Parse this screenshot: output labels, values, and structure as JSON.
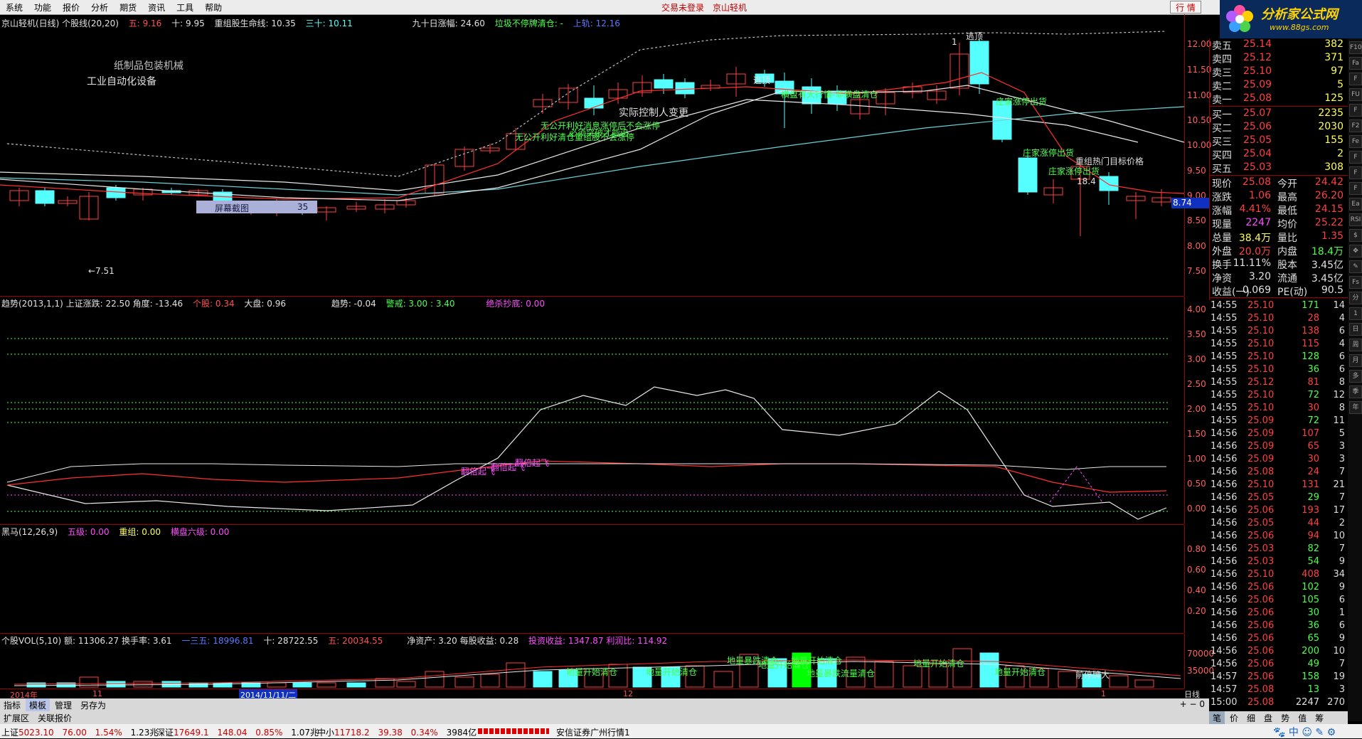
{
  "menu": {
    "items": [
      "系统",
      "功能",
      "报价",
      "分析",
      "期货",
      "资讯",
      "工具",
      "帮助"
    ],
    "center": [
      "交易未登录",
      "京山轻机"
    ],
    "quote_button": "行 情"
  },
  "logo": {
    "title": "分析家公式网",
    "url_text": "www.88gs.com"
  },
  "main_panel": {
    "header": [
      {
        "text": "京山轻机(日线) 个股线(20,20)",
        "cls": "w"
      },
      {
        "text": "五: 9.16",
        "cls": "r"
      },
      {
        "text": "十: 9.95",
        "cls": "w"
      },
      {
        "text": "重组股生命线: 10.35",
        "cls": "w"
      },
      {
        "text": "三十: 10.11",
        "cls": "c"
      },
      {
        "text": "九十日涨幅: 24.60",
        "cls": "w"
      },
      {
        "text": "垃圾不停牌清仓: -",
        "cls": "g"
      },
      {
        "text": "上轨: 12.16",
        "cls": "b"
      }
    ],
    "sector_labels": [
      "纸制品包装机械",
      "工业自动化设备"
    ],
    "y_labels": [
      "12.00",
      "11.50",
      "11.00",
      "10.50",
      "10.00",
      "9.50",
      "9.00",
      "8.50",
      "8.00",
      "7.50"
    ],
    "current_price_label": "8.74",
    "screenshot_box": {
      "label": "屏幕截图",
      "value": "35"
    },
    "low_marker": "←7.51",
    "annotations": [
      {
        "text": "逃顶",
        "cls": "w"
      },
      {
        "text": "逃顶",
        "cls": "w"
      },
      {
        "text": "实际控制人变更",
        "cls": "w"
      },
      {
        "text": "无公开利好消息涨停后不会涨停",
        "cls": "g"
      },
      {
        "text": "必须突破才能追",
        "cls": "g"
      },
      {
        "text": "无公开利好清仓重组股不会涨停",
        "cls": "g"
      },
      {
        "text": "横盘有大行情-非横盘清仓",
        "cls": "g"
      },
      {
        "text": "庄家涨停出货",
        "cls": "g"
      },
      {
        "text": "庄家涨停出货",
        "cls": "g"
      },
      {
        "text": "重组热门目标价格",
        "cls": "w"
      },
      {
        "text": "庄家涨停出货",
        "cls": "g"
      },
      {
        "text": "18.4",
        "cls": "w"
      },
      {
        "text": "1",
        "cls": "w"
      }
    ]
  },
  "trend_panel": {
    "header": [
      {
        "text": "趋势(2013,1,1) 上证涨跌: 22.50 角度: -13.46",
        "cls": "w"
      },
      {
        "text": "个股: 0.34",
        "cls": "r"
      },
      {
        "text": "大盘: 0.96",
        "cls": "w"
      },
      {
        "text": "趋势: -0.04",
        "cls": "w"
      },
      {
        "text": "警戒: 3.00 : 3.40",
        "cls": "g"
      },
      {
        "text": "绝杀抄底: 0.00",
        "cls": "m"
      }
    ],
    "y_labels": [
      "4.00",
      "3.50",
      "3.00",
      "2.50",
      "2.00",
      "1.50",
      "1.00",
      "0.50",
      "0.00"
    ],
    "annotations": [
      "翻倍起飞",
      "翻倍起飞",
      "翻倍起飞"
    ]
  },
  "horse_panel": {
    "header": [
      {
        "text": "黑马(12,26,9)",
        "cls": "w"
      },
      {
        "text": "五级: 0.00",
        "cls": "m"
      },
      {
        "text": "重组: 0.00",
        "cls": "y"
      },
      {
        "text": "横盘六级: 0.00",
        "cls": "m"
      }
    ],
    "y_labels": [
      "0.80",
      "0.60",
      "0.40",
      "0.20"
    ]
  },
  "vol_panel": {
    "header": [
      {
        "text": "个股VOL(5,10) 额: 11306.27 换手率: 3.61",
        "cls": "w"
      },
      {
        "text": "一三五: 18996.81",
        "cls": "b"
      },
      {
        "text": "十: 28722.55",
        "cls": "w"
      },
      {
        "text": "五: 20034.55",
        "cls": "r"
      },
      {
        "text": "净资产: 3.20 每股收益: 0.28",
        "cls": "w"
      },
      {
        "text": "投资收益: 1347.87 利润比: 114.92",
        "cls": "m"
      }
    ],
    "y_labels": [
      "70000",
      "35000"
    ],
    "annotations": [
      "地量开始清仓",
      "地量开始清仓",
      "地量暴跌清仓",
      "地量开始清仓",
      "地量开始清仓",
      "地量暴跌流量清仓",
      "地量开始清仓",
      "地量开始清仓",
      "前停牌大"
    ]
  },
  "date_axis": {
    "labels": [
      "2014年",
      "11",
      "2014/11/11/二",
      "12",
      "1"
    ],
    "period": "日线"
  },
  "tabs": {
    "row1": [
      "指标",
      "模板",
      "管理",
      "另存为"
    ],
    "row2": [
      "扩展区",
      "关联报价"
    ]
  },
  "quote_panel": {
    "asks": [
      {
        "label": "卖五",
        "price": "25.14",
        "vol": "382"
      },
      {
        "label": "卖四",
        "price": "25.12",
        "vol": "371"
      },
      {
        "label": "卖三",
        "price": "25.10",
        "vol": "97"
      },
      {
        "label": "卖二",
        "price": "25.09",
        "vol": "5"
      },
      {
        "label": "卖一",
        "price": "25.08",
        "vol": "125"
      }
    ],
    "bids": [
      {
        "label": "买一",
        "price": "25.07",
        "vol": "2235"
      },
      {
        "label": "买二",
        "price": "25.06",
        "vol": "2030"
      },
      {
        "label": "买三",
        "price": "25.05",
        "vol": "155"
      },
      {
        "label": "买四",
        "price": "25.04",
        "vol": "2"
      },
      {
        "label": "买五",
        "price": "25.03",
        "vol": "308"
      }
    ],
    "stats": [
      {
        "l1": "现价",
        "v1": "25.08",
        "c1": "r",
        "l2": "今开",
        "v2": "24.42",
        "c2": "r"
      },
      {
        "l1": "涨跌",
        "v1": "1.06",
        "c1": "r",
        "l2": "最高",
        "v2": "26.20",
        "c2": "r"
      },
      {
        "l1": "涨幅",
        "v1": "4.41%",
        "c1": "r",
        "l2": "最低",
        "v2": "24.15",
        "c2": "r"
      },
      {
        "l1": "现量",
        "v1": "2247",
        "c1": "m",
        "l2": "均价",
        "v2": "25.22",
        "c2": "r"
      },
      {
        "l1": "总量",
        "v1": "38.4万",
        "c1": "y",
        "l2": "量比",
        "v2": "1.35",
        "c2": "r"
      },
      {
        "l1": "外盘",
        "v1": "20.0万",
        "c1": "r",
        "l2": "内盘",
        "v2": "18.4万",
        "c2": "g"
      },
      {
        "l1": "换手",
        "v1": "11.11%",
        "c1": "w",
        "l2": "股本",
        "v2": "3.45亿",
        "c2": "w"
      },
      {
        "l1": "净资",
        "v1": "3.20",
        "c1": "w",
        "l2": "流通",
        "v2": "3.45亿",
        "c2": "w"
      },
      {
        "l1": "收益(一)",
        "v1": "0.069",
        "c1": "w",
        "l2": "PE(动)",
        "v2": "90.5",
        "c2": "w"
      }
    ],
    "ticks": [
      {
        "t": "14:55",
        "p": "25.10",
        "v": "171",
        "n": "14",
        "c": "g"
      },
      {
        "t": "14:55",
        "p": "25.10",
        "v": "28",
        "n": "4",
        "c": "r"
      },
      {
        "t": "14:55",
        "p": "25.10",
        "v": "138",
        "n": "6",
        "c": "r"
      },
      {
        "t": "14:55",
        "p": "25.10",
        "v": "115",
        "n": "4",
        "c": "r"
      },
      {
        "t": "14:55",
        "p": "25.10",
        "v": "128",
        "n": "6",
        "c": "g"
      },
      {
        "t": "14:55",
        "p": "25.10",
        "v": "36",
        "n": "6",
        "c": "g"
      },
      {
        "t": "14:55",
        "p": "25.12",
        "v": "81",
        "n": "8",
        "c": "r"
      },
      {
        "t": "14:55",
        "p": "25.10",
        "v": "72",
        "n": "12",
        "c": "g"
      },
      {
        "t": "14:55",
        "p": "25.10",
        "v": "30",
        "n": "8",
        "c": "r"
      },
      {
        "t": "14:55",
        "p": "25.09",
        "v": "72",
        "n": "11",
        "c": "g"
      },
      {
        "t": "14:56",
        "p": "25.09",
        "v": "107",
        "n": "5",
        "c": "r"
      },
      {
        "t": "14:56",
        "p": "25.09",
        "v": "65",
        "n": "3",
        "c": "r"
      },
      {
        "t": "14:56",
        "p": "25.09",
        "v": "30",
        "n": "3",
        "c": "r"
      },
      {
        "t": "14:56",
        "p": "25.08",
        "v": "24",
        "n": "7",
        "c": "r"
      },
      {
        "t": "14:56",
        "p": "25.10",
        "v": "131",
        "n": "21",
        "c": "r"
      },
      {
        "t": "14:56",
        "p": "25.05",
        "v": "29",
        "n": "7",
        "c": "g"
      },
      {
        "t": "14:56",
        "p": "25.06",
        "v": "193",
        "n": "17",
        "c": "r"
      },
      {
        "t": "14:56",
        "p": "25.05",
        "v": "44",
        "n": "2",
        "c": "r"
      },
      {
        "t": "14:56",
        "p": "25.06",
        "v": "94",
        "n": "10",
        "c": "r"
      },
      {
        "t": "14:56",
        "p": "25.03",
        "v": "82",
        "n": "7",
        "c": "g"
      },
      {
        "t": "14:56",
        "p": "25.03",
        "v": "54",
        "n": "9",
        "c": "g"
      },
      {
        "t": "14:56",
        "p": "25.10",
        "v": "408",
        "n": "34",
        "c": "r"
      },
      {
        "t": "14:56",
        "p": "25.06",
        "v": "102",
        "n": "9",
        "c": "g"
      },
      {
        "t": "14:56",
        "p": "25.06",
        "v": "105",
        "n": "6",
        "c": "g"
      },
      {
        "t": "14:56",
        "p": "25.06",
        "v": "30",
        "n": "1",
        "c": "g"
      },
      {
        "t": "14:56",
        "p": "25.06",
        "v": "36",
        "n": "6",
        "c": "g"
      },
      {
        "t": "14:56",
        "p": "25.06",
        "v": "65",
        "n": "9",
        "c": "g"
      },
      {
        "t": "14:56",
        "p": "25.06",
        "v": "200",
        "n": "10",
        "c": "g"
      },
      {
        "t": "14:56",
        "p": "25.06",
        "v": "49",
        "n": "7",
        "c": "g"
      },
      {
        "t": "14:57",
        "p": "25.06",
        "v": "158",
        "n": "19",
        "c": "g"
      },
      {
        "t": "14:57",
        "p": "25.08",
        "v": "13",
        "n": "3",
        "c": "g"
      },
      {
        "t": "15:00",
        "p": "25.08",
        "v": "2247",
        "n": "270",
        "c": "w"
      }
    ],
    "bottom_tabs": [
      "笔",
      "价",
      "细",
      "盘",
      "势",
      "值",
      "筹"
    ]
  },
  "side_tools": [
    "F10",
    "Fa",
    "F",
    "FU",
    "F",
    "F2",
    "Fe",
    "F",
    "F",
    "F",
    "Ea",
    "RSI",
    "$",
    "✥",
    "✎",
    "Fs",
    "分",
    "1",
    "日",
    "周",
    "月",
    "多",
    "季",
    "年"
  ],
  "statusbar": {
    "sh": {
      "label": "上证",
      "index": "5023.10",
      "chg": "76.00",
      "pct": "1.54%",
      "amt": "1.23兆"
    },
    "sz": {
      "label": "深证",
      "index": "17649.1",
      "chg": "148.04",
      "pct": "0.85%",
      "amt": "1.07兆"
    },
    "zx": {
      "label": "中小",
      "index": "11718.2",
      "chg": "39.38",
      "pct": "0.34%",
      "amt": "3984亿"
    },
    "broker": "安信证券广州行情1",
    "icons": [
      "中",
      "☺",
      "✎",
      "⚙"
    ]
  }
}
